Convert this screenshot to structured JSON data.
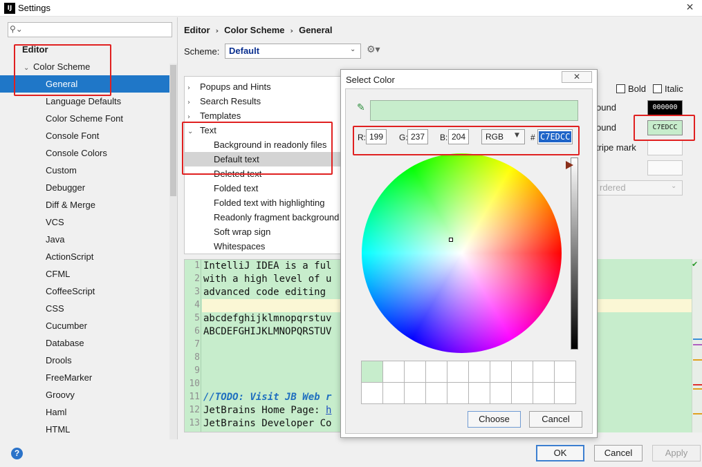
{
  "window": {
    "title": "Settings",
    "app_icon": "IJ",
    "close_glyph": "✕"
  },
  "sidebar": {
    "search_placeholder": "",
    "items": [
      {
        "label": "Editor",
        "level": 0,
        "bold": true
      },
      {
        "label": "Color Scheme",
        "level": 1,
        "expanded": true
      },
      {
        "label": "General",
        "level": 2,
        "selected": true
      },
      {
        "label": "Language Defaults",
        "level": 2
      },
      {
        "label": "Color Scheme Font",
        "level": 2
      },
      {
        "label": "Console Font",
        "level": 2
      },
      {
        "label": "Console Colors",
        "level": 2
      },
      {
        "label": "Custom",
        "level": 2
      },
      {
        "label": "Debugger",
        "level": 2
      },
      {
        "label": "Diff & Merge",
        "level": 2
      },
      {
        "label": "VCS",
        "level": 2
      },
      {
        "label": "Java",
        "level": 2
      },
      {
        "label": "ActionScript",
        "level": 2
      },
      {
        "label": "CFML",
        "level": 2
      },
      {
        "label": "CoffeeScript",
        "level": 2
      },
      {
        "label": "CSS",
        "level": 2
      },
      {
        "label": "Cucumber",
        "level": 2
      },
      {
        "label": "Database",
        "level": 2
      },
      {
        "label": "Drools",
        "level": 2
      },
      {
        "label": "FreeMarker",
        "level": 2
      },
      {
        "label": "Groovy",
        "level": 2
      },
      {
        "label": "Haml",
        "level": 2
      },
      {
        "label": "HTML",
        "level": 2
      }
    ]
  },
  "breadcrumb": [
    "Editor",
    "Color Scheme",
    "General"
  ],
  "scheme": {
    "label": "Scheme:",
    "value": "Default"
  },
  "element_tree": [
    {
      "label": "Popups and Hints",
      "level": 0,
      "arrow": "›"
    },
    {
      "label": "Search Results",
      "level": 0,
      "arrow": "›"
    },
    {
      "label": "Templates",
      "level": 0,
      "arrow": "›"
    },
    {
      "label": "Text",
      "level": 0,
      "arrow": "⌄"
    },
    {
      "label": "Background in readonly files",
      "level": 1
    },
    {
      "label": "Default text",
      "level": 1,
      "selected": true
    },
    {
      "label": "Deleted text",
      "level": 1
    },
    {
      "label": "Folded text",
      "level": 1
    },
    {
      "label": "Folded text with highlighting",
      "level": 1
    },
    {
      "label": "Readonly fragment background",
      "level": 1
    },
    {
      "label": "Soft wrap sign",
      "level": 1
    },
    {
      "label": "Whitespaces",
      "level": 1
    }
  ],
  "preview": {
    "lines": [
      {
        "no": "1",
        "text": "IntelliJ IDEA is a ful"
      },
      {
        "no": "2",
        "text": "with a high level of u"
      },
      {
        "no": "3",
        "text": "advanced code editing"
      },
      {
        "no": "4",
        "text": ""
      },
      {
        "no": "5",
        "text": "abcdefghijklmnopqrstuv"
      },
      {
        "no": "6",
        "text": "ABCDEFGHIJKLMNOPQRSTUV"
      },
      {
        "no": "7",
        "text": ""
      },
      {
        "no": "8",
        "text": ""
      },
      {
        "no": "9",
        "text": ""
      },
      {
        "no": "10",
        "text": ""
      },
      {
        "no": "11",
        "text": "//TODO: Visit JB Web r",
        "style": "todo"
      },
      {
        "no": "12",
        "text": "JetBrains Home Page: ",
        "link": "h"
      },
      {
        "no": "13",
        "text": "JetBrains Developer Co"
      }
    ]
  },
  "attributes": {
    "bold_label": "Bold",
    "italic_label": "Italic",
    "foreground_label": "ound",
    "foreground_value": "000000",
    "background_label": "ound",
    "background_value": "C7EDCC",
    "stripe_label": "tripe mark",
    "effect_value": "rdered"
  },
  "color_dialog": {
    "title": "Select Color",
    "close_glyph": "✕",
    "r_label": "R:",
    "r_value": "199",
    "g_label": "G:",
    "g_value": "237",
    "b_label": "B:",
    "b_value": "204",
    "mode": "RGB",
    "hash": "#",
    "hex_value": "C7EDCC",
    "brightness_level": 0.04,
    "choose_label": "Choose",
    "cancel_label": "Cancel"
  },
  "buttons": {
    "help": "?",
    "ok": "OK",
    "cancel": "Cancel",
    "apply": "Apply"
  },
  "colors": {
    "selected_color": "#c7edcc",
    "accent": "#1f77c8",
    "highlight": "#e02020"
  }
}
